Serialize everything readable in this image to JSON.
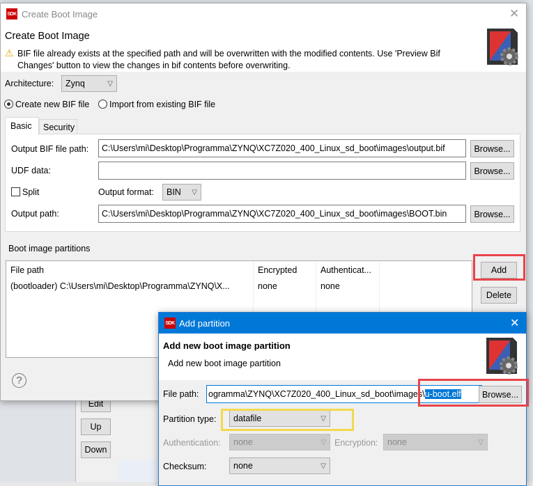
{
  "main_dialog": {
    "window_title": "Create Boot Image",
    "header_title": "Create Boot Image",
    "warning": "BIF file already exists at the specified path and will be overwritten with the modified contents. Use 'Preview Bif Changes' button to view the changes in bif contents before overwriting.",
    "architecture_label": "Architecture:",
    "architecture_value": "Zynq",
    "radio_create": "Create new BIF file",
    "radio_import": "Import from existing BIF file",
    "radio_selected": "create",
    "tabs": [
      {
        "label": "Basic",
        "active": true
      },
      {
        "label": "Security",
        "active": false
      }
    ],
    "output_bif_label": "Output BIF file path:",
    "output_bif_value": "C:\\Users\\mi\\Desktop\\Programma\\ZYNQ\\XC7Z020_400_Linux_sd_boot\\images\\output.bif",
    "udf_label": "UDF data:",
    "udf_value": "",
    "split_label": "Split",
    "split_checked": false,
    "output_format_label": "Output format:",
    "output_format_value": "BIN",
    "output_path_label": "Output path:",
    "output_path_value": "C:\\Users\\mi\\Desktop\\Programma\\ZYNQ\\XC7Z020_400_Linux_sd_boot\\images\\BOOT.bin",
    "browse_label": "Browse...",
    "partitions_label": "Boot image partitions",
    "columns": [
      "File path",
      "Encrypted",
      "Authenticat..."
    ],
    "rows": [
      [
        "(bootloader) C:\\Users\\mi\\Desktop\\Programma\\ZYNQ\\X...",
        "none",
        "none"
      ]
    ],
    "add_label": "Add",
    "delete_label": "Delete",
    "help_icon": "question-circle-icon"
  },
  "background_buttons": {
    "edit": "Edit",
    "up": "Up",
    "down": "Down"
  },
  "add_partition_dialog": {
    "window_title": "Add partition",
    "header_title": "Add new boot image partition",
    "header_subtitle": "Add new boot image partition",
    "file_path_label": "File path:",
    "file_path_value_prefix": "ogramma\\ZYNQ\\XC7Z020_400_Linux_sd_boot\\images\\",
    "file_path_value_selected": "u-boot.elf",
    "browse_label": "Browse...",
    "partition_type_label": "Partition type:",
    "partition_type_value": "datafile",
    "authentication_label": "Authentication:",
    "authentication_value": "none",
    "encryption_label": "Encryption:",
    "encryption_value": "none",
    "checksum_label": "Checksum:",
    "checksum_value": "none"
  },
  "colors": {
    "titlebar_active": "#0078d7",
    "highlight_red": "#e8434a",
    "highlight_yellow": "#f2d94e",
    "selection": "#0078d7"
  }
}
